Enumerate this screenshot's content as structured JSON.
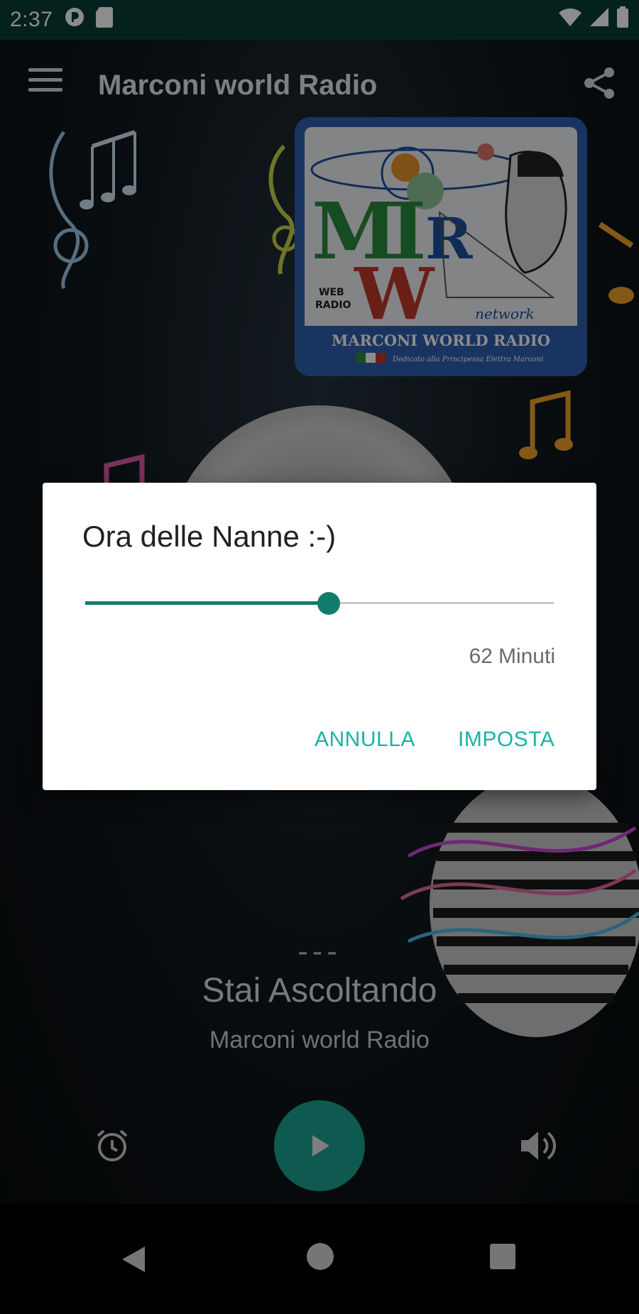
{
  "status_bar": {
    "time": "2:37",
    "icons": [
      "pocket-casts-icon",
      "sd-card-icon",
      "wifi-icon",
      "cell-signal-icon",
      "battery-icon"
    ]
  },
  "toolbar": {
    "title": "Marconi world Radio",
    "menu_icon": "hamburger-menu-icon",
    "share_icon": "share-icon"
  },
  "logo": {
    "big_letters": "MRW",
    "web_radio": "WEB RADIO",
    "network": "network",
    "name": "MARCONI WORLD RADIO",
    "dedication": "Dedicato alla Principessa Elettra Marconi"
  },
  "now_playing": {
    "dashes": "---",
    "heading": "Stai Ascoltando",
    "station": "Marconi world Radio"
  },
  "controls": {
    "alarm_icon": "alarm-clock-icon",
    "play_icon": "play-icon",
    "volume_icon": "volume-icon"
  },
  "dialog": {
    "title": "Ora delle Nanne :-)",
    "slider_fraction": 0.52,
    "value": "62",
    "unit": "Minuti",
    "cancel_label": "ANNULLA",
    "set_label": "IMPOSTA"
  },
  "colors": {
    "accent": "#19b3a3",
    "slider": "#0f7c6e",
    "status_bar": "#0a3d38",
    "play_button": "#1aa593"
  }
}
